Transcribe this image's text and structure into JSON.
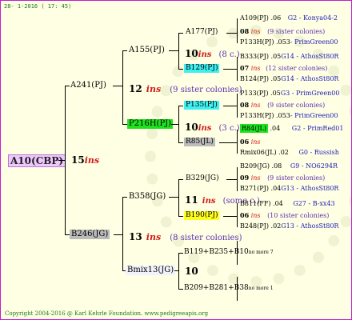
{
  "header": {
    "date": "28- 1-2016 ( 17: 45)"
  },
  "footer": {
    "copyright": "Copyright 2004-2016 @ Karl Kehrle Foundation.   www.pedigreeapis.org"
  },
  "root": {
    "id": "A10(CBP)",
    "num": "15",
    "ins": "ins"
  },
  "parents": [
    {
      "id": "A241(PJ)",
      "num": "12",
      "ins": "ins",
      "sisters": "(9 sister colonies)"
    },
    {
      "id": "B246(JG)",
      "num": "13",
      "ins": "ins",
      "sisters": "(8 sister colonies)"
    }
  ],
  "grandparents": [
    {
      "id": "A155(PJ)",
      "num": "10",
      "ins": "ins",
      "sisters": "(8 c.)"
    },
    {
      "id": "P216H(PJ)",
      "num": "10",
      "ins": "ins",
      "sisters": "(3 c.)"
    },
    {
      "id": "B358(JG)",
      "num": "11",
      "ins": "ins",
      "sisters": "(some c.)"
    },
    {
      "id": "Bmix13(JG)",
      "num": "10",
      "ins": "",
      "sisters": ""
    }
  ],
  "ggparents": [
    {
      "id": "A177(PJ)"
    },
    {
      "id": "B129(PJ)"
    },
    {
      "id": "P135(PJ)"
    },
    {
      "id": "R85(JL)"
    },
    {
      "id": "B329(JG)"
    },
    {
      "id": "B190(PJ)"
    },
    {
      "id": "B119+B235+B10",
      "suffix": "no more 7"
    },
    {
      "id": "B209+B281+B38",
      "suffix": "no more 1"
    }
  ],
  "g4": [
    {
      "a": "A109(PJ)",
      "an": ".06",
      "as": "G2 - Konya04-2",
      "num": "08",
      "ins": "ins",
      "sis": "(9 sister colonies)",
      "b": "P133H(PJ)",
      "bn": ".053",
      "bs": "- PrimGreen00"
    },
    {
      "a": "B333(PJ)",
      "an": ".05",
      "as": "G14 - AthosSt80R",
      "num": "07",
      "ins": "ins",
      "sis": "(12 sister colonies)",
      "b": "B124(PJ)",
      "bn": ".05",
      "bs": "G14 - AthosSt80R"
    },
    {
      "a": "P133(PJ)",
      "an": ".05",
      "as": "G3 - PrimGreen00",
      "num": "08",
      "ins": "ins",
      "sis": "(9 sister colonies)",
      "b": "P133H(PJ)",
      "bn": ".053",
      "bs": "- PrimGreen00"
    },
    {
      "a": "R84(JL)",
      "an": ".04",
      "as": "G2 - PrimRed01",
      "num": "06",
      "ins": "ins",
      "sis": "",
      "b": "Rmix06(JL)",
      "bn": ".02",
      "bs": "G0 - Russish"
    },
    {
      "a": "B209(JG)",
      "an": ".08",
      "as": "G9 - NO6294R",
      "num": "09",
      "ins": "ins",
      "sis": "(9 sister colonies)",
      "b": "B271(PJ)",
      "bn": ".04",
      "bs": "G13 - AthosSt80R"
    },
    {
      "a": "B811(FF)",
      "an": ".04",
      "as": "G27 - B-xx43",
      "num": "06",
      "ins": "ins",
      "sis": "(10 sister colonies)",
      "b": "B248(PJ)",
      "bn": ".02",
      "bs": "G13 - AthosSt80R"
    }
  ]
}
